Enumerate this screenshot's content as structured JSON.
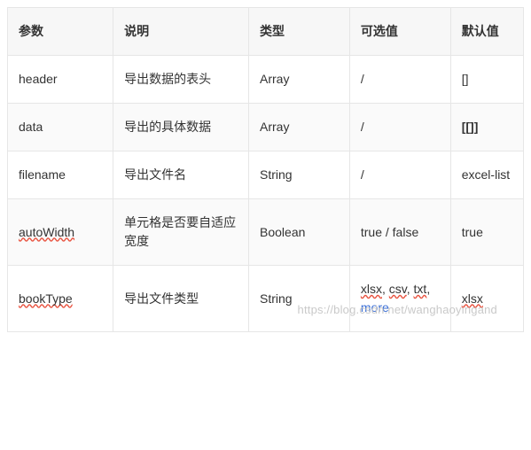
{
  "headers": {
    "param": "参数",
    "desc": "说明",
    "type": "类型",
    "opts": "可选值",
    "def": "默认值"
  },
  "rows": [
    {
      "param": "header",
      "desc": "导出数据的表头",
      "type": "Array",
      "opts": "/",
      "def": "[]"
    },
    {
      "param": "data",
      "desc": "导出的具体数据",
      "type": "Array",
      "opts": "/",
      "def": "[[]]"
    },
    {
      "param": "filename",
      "desc": "导出文件名",
      "type": "String",
      "opts": "/",
      "def": "excel-list"
    },
    {
      "param": "autoWidth",
      "desc": "单元格是否要自适应宽度",
      "type": "Boolean",
      "opts_parts": {
        "a": "true / false"
      },
      "def": "true"
    },
    {
      "param": "bookType",
      "desc": "导出文件类型",
      "type": "String",
      "opts_parts": {
        "a": "xlsx",
        "b": "csv",
        "c": "txt",
        "more": "more"
      },
      "def": "xlsx"
    }
  ],
  "watermark": "https://blog.csdn.net/wanghaoyingand"
}
